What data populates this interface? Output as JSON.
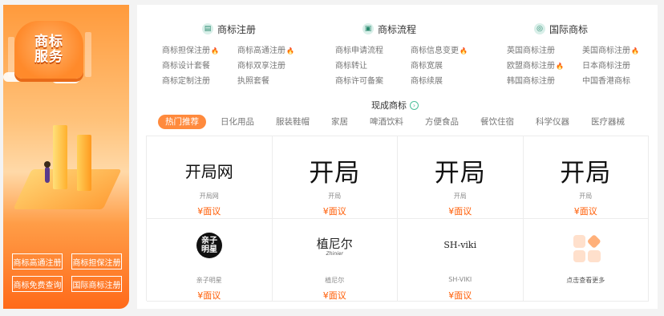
{
  "banner": {
    "badge_line1": "商标",
    "badge_line2": "服务",
    "buttons": [
      "商标高通注册",
      "商标担保注册",
      "商标免费查询",
      "国际商标注册"
    ]
  },
  "categories": [
    {
      "title": "商标注册",
      "icon": "document-icon",
      "links": [
        {
          "label": "商标担保注册",
          "hot": true
        },
        {
          "label": "商标高通注册",
          "hot": true
        },
        {
          "label": "商标设计套餐",
          "hot": false
        },
        {
          "label": "商标双享注册",
          "hot": false
        },
        {
          "label": "商标定制注册",
          "hot": false
        },
        {
          "label": "执照套餐",
          "hot": false
        }
      ]
    },
    {
      "title": "商标流程",
      "icon": "flow-icon",
      "links": [
        {
          "label": "商标申请流程",
          "hot": false
        },
        {
          "label": "商标信息变更",
          "hot": true
        },
        {
          "label": "商标转让",
          "hot": false
        },
        {
          "label": "商标宽展",
          "hot": false
        },
        {
          "label": "商标许可备案",
          "hot": false
        },
        {
          "label": "商标续展",
          "hot": false
        }
      ]
    },
    {
      "title": "国际商标",
      "icon": "globe-icon",
      "links": [
        {
          "label": "英国商标注册",
          "hot": false
        },
        {
          "label": "美国商标注册",
          "hot": true
        },
        {
          "label": "欧盟商标注册",
          "hot": true
        },
        {
          "label": "日本商标注册",
          "hot": false
        },
        {
          "label": "韩国商标注册",
          "hot": false
        },
        {
          "label": "中国香港商标",
          "hot": false
        }
      ]
    }
  ],
  "section_title": "现成商标",
  "tabs": [
    "热门推荐",
    "日化用品",
    "服装鞋帽",
    "家居",
    "啤酒饮料",
    "方便食品",
    "餐饮住宿",
    "科学仪器",
    "医疗器械"
  ],
  "active_tab": "热门推荐",
  "cards_row1": [
    {
      "logo": "开局网",
      "name": "开局网",
      "price": "¥面议"
    },
    {
      "logo": "开局",
      "name": "开局",
      "price": "¥面议"
    },
    {
      "logo": "开局",
      "name": "开局",
      "price": "¥面议"
    },
    {
      "logo": "开局",
      "name": "开局",
      "price": "¥面议"
    }
  ],
  "cards_row2": [
    {
      "logo_top": "亲子",
      "logo_bottom": "明星",
      "name": "亲子明星",
      "price": "¥面议"
    },
    {
      "logo_top": "植尼尔",
      "logo_bottom": "Zhinier",
      "name": "植尼尔",
      "price": "¥面议"
    },
    {
      "logo": "SH-viki",
      "name": "SH-VIKI",
      "price": "¥面议"
    }
  ],
  "more_label": "点击查看更多",
  "colors": {
    "accent": "#ff8a3d",
    "price": "#ff5a00",
    "hot": "#ff6a1a"
  }
}
